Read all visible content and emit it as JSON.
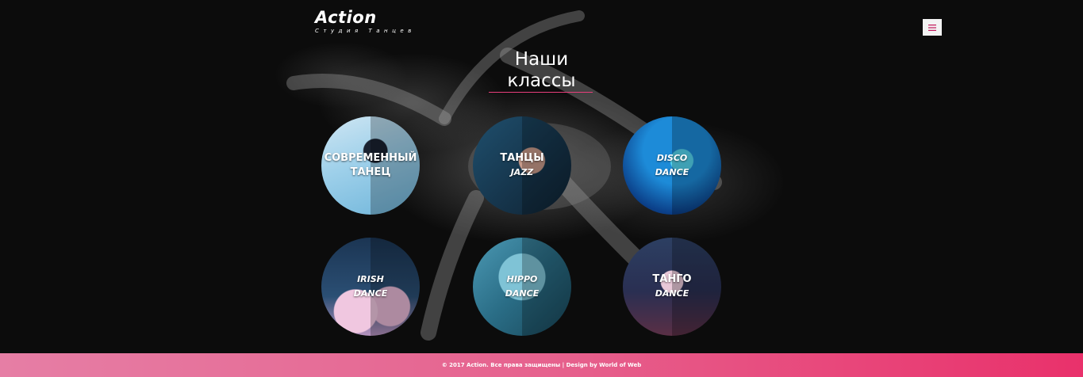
{
  "header": {
    "logo_title": "Action",
    "logo_subtitle": "Студия Танцев",
    "menu_icon": "hamburger-icon"
  },
  "section": {
    "title_line1": "Наши",
    "title_line2": "классы",
    "accent_color": "#e83e7b"
  },
  "classes": [
    {
      "line1": "СОВРЕМЕННЫЙ",
      "line2": "ТАНЕЦ"
    },
    {
      "line1": "ТАНЦЫ",
      "line2": "JAZZ"
    },
    {
      "line1": "DISCO",
      "line2": "DANCE"
    },
    {
      "line1": "IRISH",
      "line2": "DANCE"
    },
    {
      "line1": "HIPPO",
      "line2": "DANCE"
    },
    {
      "line1": "ТАНГО",
      "line2": "DANCE"
    }
  ],
  "footer": {
    "text": "© 2017 Action. Все права защищены | Design by World of Web",
    "gradient_start": "#e67ea5",
    "gradient_end": "#e9316b"
  }
}
